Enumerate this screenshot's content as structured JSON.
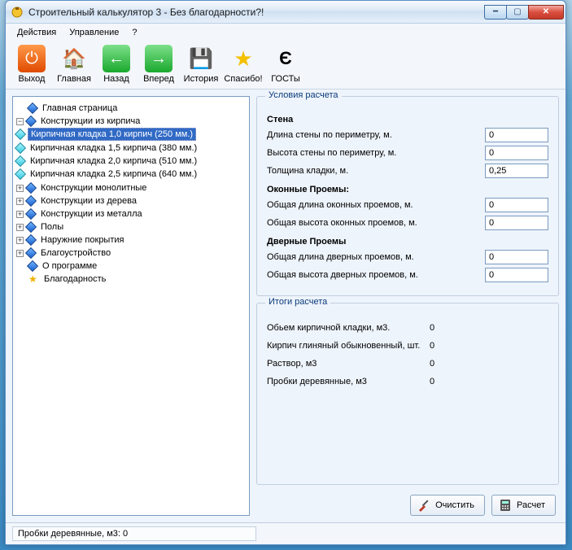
{
  "window": {
    "title": "Строительный калькулятор 3 - Без благодарности?!"
  },
  "menu": {
    "actions": "Действия",
    "manage": "Управление",
    "help": "?"
  },
  "toolbar": {
    "exit": "Выход",
    "home": "Главная",
    "back": "Назад",
    "forward": "Вперед",
    "history": "История",
    "thanks": "Спасибо!",
    "gost": "ГОСТы"
  },
  "tree": {
    "main_page": "Главная страница",
    "brick": {
      "label": "Конструкции из кирпича",
      "items": [
        "Кирпичная кладка 1,0 кирпич (250 мм.)",
        "Кирпичная кладка 1,5 кирпича (380 мм.)",
        "Кирпичная кладка 2,0 кирпича  (510 мм.)",
        "Кирпичная кладка 2,5 кирпича  (640 мм.)"
      ]
    },
    "monolith": "Конструкции монолитные",
    "wood": "Конструкции из дерева",
    "metal": "Конструкции из металла",
    "floors": "Полы",
    "outer": "Наружние покрытия",
    "landscaping": "Благоустройство",
    "about": "О программе",
    "gratitude": "Благодарность"
  },
  "conditions": {
    "group_title": "Условия расчета",
    "wall_hd": "Стена",
    "wall_len_lbl": "Длина стены по периметру, м.",
    "wall_len_val": "0",
    "wall_h_lbl": "Высота стены по периметру, м.",
    "wall_h_val": "0",
    "thick_lbl": "Толщина кладки, м.",
    "thick_val": "0,25",
    "win_hd": "Оконные Проемы:",
    "win_len_lbl": "Общая длина оконных проемов, м.",
    "win_len_val": "0",
    "win_h_lbl": "Общая высота оконных проемов, м.",
    "win_h_val": "0",
    "door_hd": "Дверные Проемы",
    "door_len_lbl": "Общая длина дверных проемов, м.",
    "door_len_val": "0",
    "door_h_lbl": "Общая высота дверных проемов, м.",
    "door_h_val": "0"
  },
  "results": {
    "group_title": "Итоги расчета",
    "rows": [
      {
        "lbl": "Обьем кирпичной кладки, м3.",
        "val": "0"
      },
      {
        "lbl": "Кирпич глиняный обыкновенный, шт.",
        "val": "0"
      },
      {
        "lbl": "Раствор, м3",
        "val": "0"
      },
      {
        "lbl": "Пробки деревянные, м3",
        "val": "0"
      }
    ]
  },
  "buttons": {
    "clear": "Очистить",
    "calc": "Расчет"
  },
  "status": "Пробки деревянные, м3: 0"
}
